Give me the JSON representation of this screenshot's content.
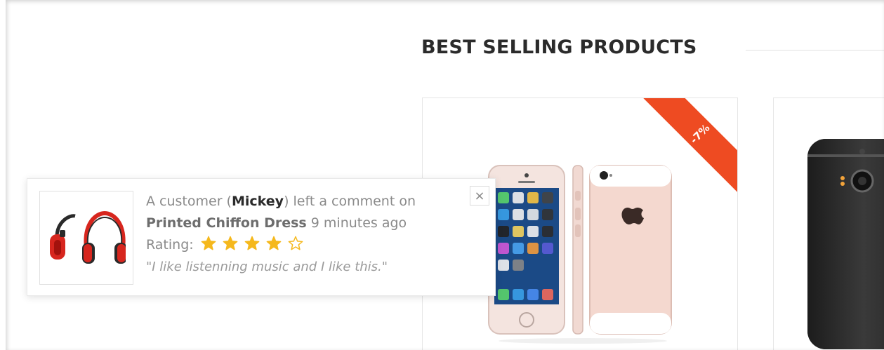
{
  "section": {
    "title": "BEST SELLING PRODUCTS"
  },
  "products": [
    {
      "badge": "-7%",
      "image_icon": "iphone-se-rose-gold-image"
    },
    {
      "image_icon": "dark-smartphone-image"
    }
  ],
  "notification": {
    "prefix": "A customer",
    "customer_name": "Mickey",
    "middle": "left a comment on",
    "product_name": "Printed Chiffon Dress",
    "time_ago": "9 minutes ago",
    "rating_label": "Rating:",
    "rating": 4,
    "rating_max": 5,
    "comment": "\"I like listenning music and I like this.\"",
    "close_symbol": "×",
    "thumbnail_icon": "red-headphones-image"
  },
  "colors": {
    "ribbon": "#ee4b22",
    "star": "#f5b81c",
    "title": "#2b2b2b"
  }
}
